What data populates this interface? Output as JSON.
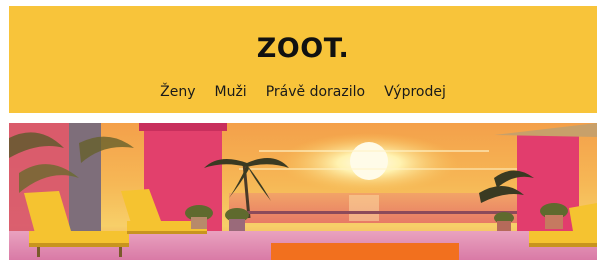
{
  "header": {
    "logo": "ZOOT.",
    "background_color": "#f8c43a",
    "nav": [
      {
        "label": "Ženy"
      },
      {
        "label": "Muži"
      },
      {
        "label": "Právě dorazilo"
      },
      {
        "label": "Výprodej"
      }
    ]
  },
  "banner": {
    "scene": "sunset-terrace-illustration",
    "colors": {
      "sky_top": "#f5a24a",
      "sky_bottom": "#f7d46a",
      "sun": "#fffbe8",
      "sea": "#f28a5f",
      "wall": "#e23d6d",
      "loungers": "#f5c330",
      "floor": "#e79bb6"
    }
  }
}
